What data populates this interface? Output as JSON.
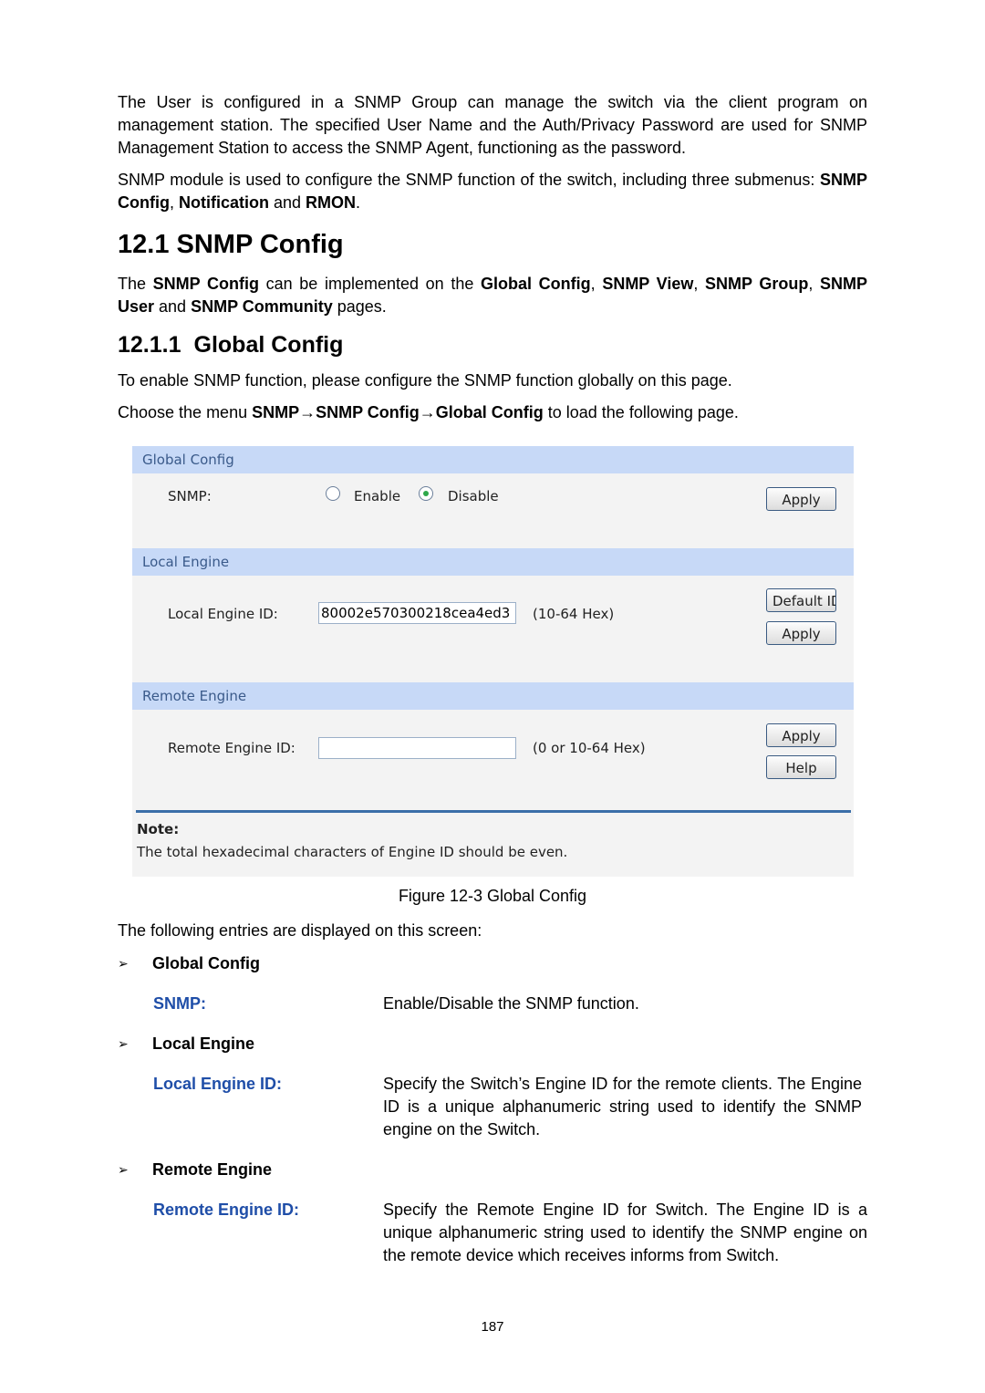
{
  "intro": {
    "p1": "The User is configured in a SNMP Group can manage the switch via the client program on management station. The specified User Name and the Auth/Privacy Password are used for SNMP Management Station to access the SNMP Agent, functioning as the password.",
    "p2_a": "SNMP module is used to configure the SNMP function of the switch, including three submenus: ",
    "p2_b1": "SNMP Config",
    "p2_sep1": ", ",
    "p2_b2": "Notification",
    "p2_sep2": " and ",
    "p2_b3": "RMON",
    "p2_end": "."
  },
  "section": {
    "number": "12.1",
    "title": "SNMP Config",
    "p_a": "The ",
    "p_b1": "SNMP Config",
    "p_c": " can be implemented on the ",
    "p_b2": "Global Config",
    "p_s1": ", ",
    "p_b3": "SNMP View",
    "p_s2": ", ",
    "p_b4": "SNMP Group",
    "p_s3": ", ",
    "p_b5": "SNMP User",
    "p_s4": " and ",
    "p_b6": "SNMP Community",
    "p_end": " pages."
  },
  "subsection": {
    "number": "12.1.1",
    "title": "Global Config",
    "p1": "To enable SNMP function, please configure the SNMP function globally on this page.",
    "p2_a": "Choose the menu ",
    "p2_menu": "SNMP→SNMP Config→Global Config",
    "p2_end": " to load the following page."
  },
  "figure": {
    "global_config": {
      "header": "Global Config",
      "snmp_label": "SNMP:",
      "enable_label": "Enable",
      "disable_label": "Disable",
      "selected": "Disable",
      "apply_label": "Apply"
    },
    "local_engine": {
      "header": "Local Engine",
      "id_label": "Local Engine ID:",
      "id_value": "80002e570300218cea4ed3",
      "hint": "(10-64 Hex)",
      "default_id_label": "Default ID",
      "apply_label": "Apply"
    },
    "remote_engine": {
      "header": "Remote Engine",
      "id_label": "Remote Engine ID:",
      "id_value": "",
      "hint": "(0 or 10-64 Hex)",
      "apply_label": "Apply",
      "help_label": "Help"
    },
    "note": {
      "title": "Note:",
      "text": "The total hexadecimal characters of Engine ID should be even."
    },
    "caption": "Figure 12-3 Global Config"
  },
  "entries": {
    "intro": "The following entries are displayed on this screen:",
    "groups": [
      {
        "title": "Global Config",
        "items": [
          {
            "term": "SNMP:",
            "desc": "Enable/Disable the SNMP function."
          }
        ]
      },
      {
        "title": "Local Engine",
        "items": [
          {
            "term": "Local Engine ID:",
            "desc": "Specify the Switch’s Engine ID for the remote clients. The Engine ID is a unique alphanumeric string used to identify the SNMP engine on the Switch."
          }
        ]
      },
      {
        "title": "Remote Engine",
        "items": [
          {
            "term": "Remote Engine ID:",
            "desc": "Specify the Remote Engine ID for Switch. The Engine ID is a unique alphanumeric string used to identify the SNMP engine on the remote device which receives informs from Switch."
          }
        ]
      }
    ]
  },
  "bullet_glyph": "➢",
  "page_number": "187"
}
